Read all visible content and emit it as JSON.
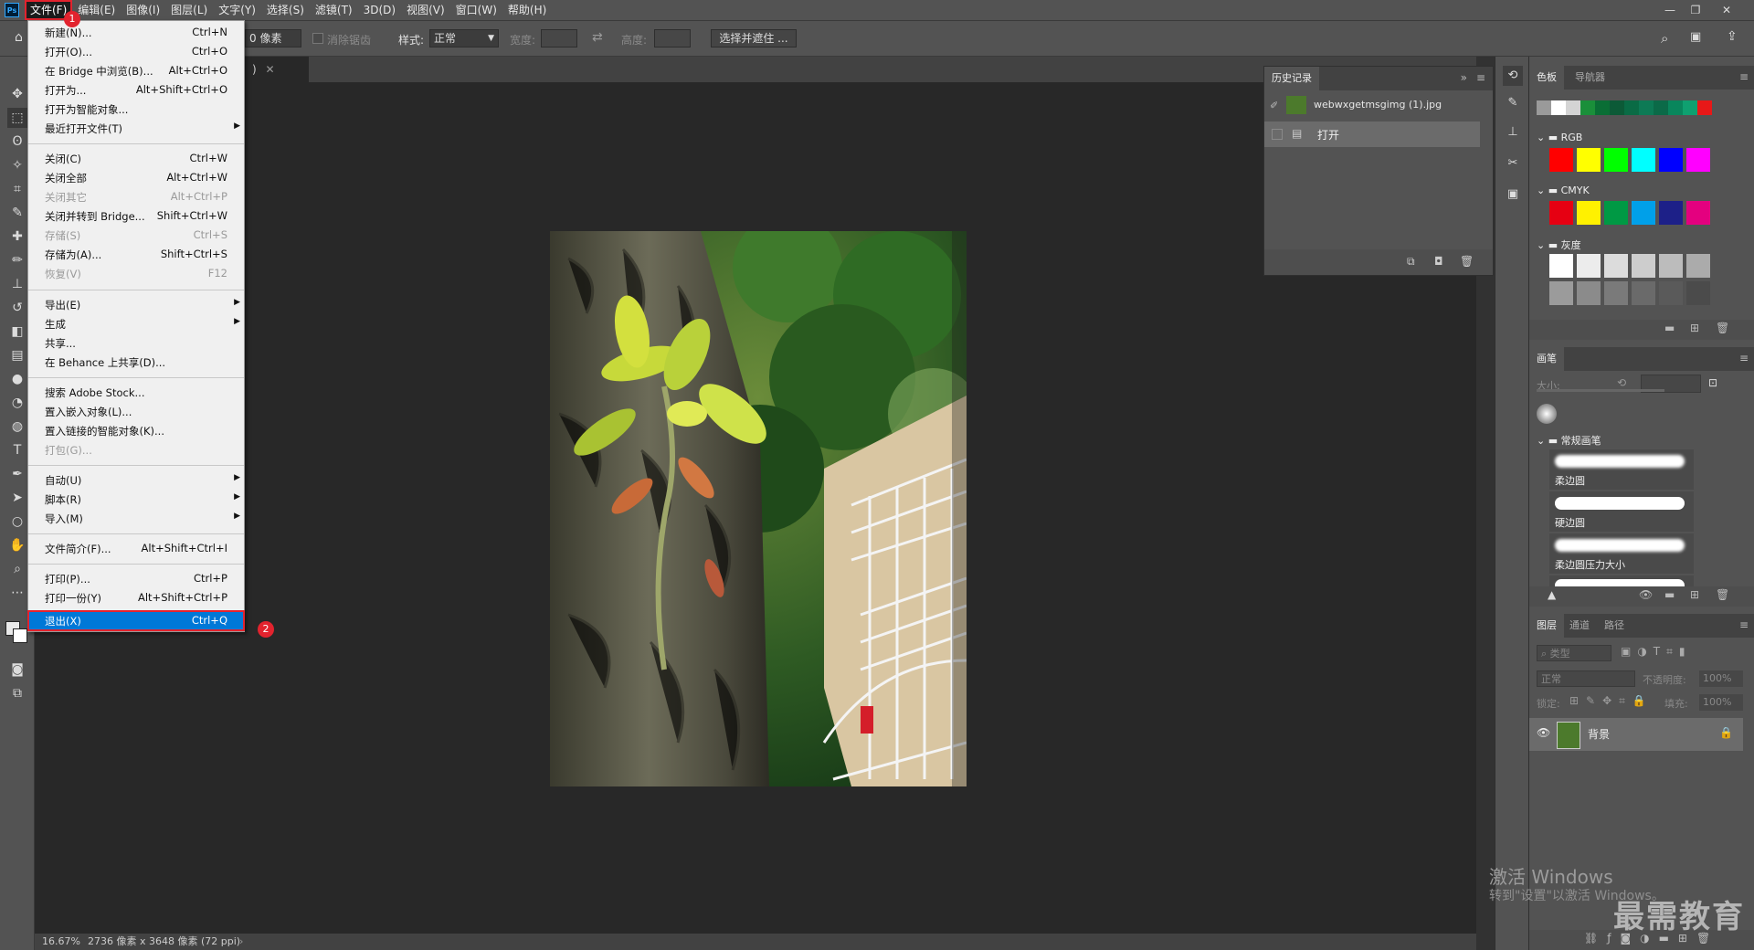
{
  "menubar": {
    "logo": "Ps",
    "items": [
      "文件(F)",
      "编辑(E)",
      "图像(I)",
      "图层(L)",
      "文字(Y)",
      "选择(S)",
      "滤镜(T)",
      "3D(D)",
      "视图(V)",
      "窗口(W)",
      "帮助(H)"
    ]
  },
  "options_bar": {
    "feather_value": "0 像素",
    "antialias_label": "消除锯齿",
    "style_label": "样式:",
    "style_value": "正常",
    "width_label": "宽度:",
    "height_label": "高度:",
    "select_mask_label": "选择并遮住 ..."
  },
  "file_menu": {
    "items": [
      {
        "label": "新建(N)...",
        "shortcut": "Ctrl+N"
      },
      {
        "label": "打开(O)...",
        "shortcut": "Ctrl+O"
      },
      {
        "label": "在 Bridge 中浏览(B)...",
        "shortcut": "Alt+Ctrl+O"
      },
      {
        "label": "打开为...",
        "shortcut": "Alt+Shift+Ctrl+O"
      },
      {
        "label": "打开为智能对象...",
        "shortcut": ""
      },
      {
        "label": "最近打开文件(T)",
        "shortcut": ""
      },
      {
        "label": "关闭(C)",
        "shortcut": "Ctrl+W"
      },
      {
        "label": "关闭全部",
        "shortcut": "Alt+Ctrl+W"
      },
      {
        "label": "关闭其它",
        "shortcut": "Alt+Ctrl+P"
      },
      {
        "label": "关闭并转到 Bridge...",
        "shortcut": "Shift+Ctrl+W"
      },
      {
        "label": "存储(S)",
        "shortcut": "Ctrl+S"
      },
      {
        "label": "存储为(A)...",
        "shortcut": "Shift+Ctrl+S"
      },
      {
        "label": "恢复(V)",
        "shortcut": "F12"
      },
      {
        "label": "导出(E)",
        "shortcut": ""
      },
      {
        "label": "生成",
        "shortcut": ""
      },
      {
        "label": "共享...",
        "shortcut": ""
      },
      {
        "label": "在 Behance 上共享(D)...",
        "shortcut": ""
      },
      {
        "label": "搜索 Adobe Stock...",
        "shortcut": ""
      },
      {
        "label": "置入嵌入对象(L)...",
        "shortcut": ""
      },
      {
        "label": "置入链接的智能对象(K)...",
        "shortcut": ""
      },
      {
        "label": "打包(G)...",
        "shortcut": ""
      },
      {
        "label": "自动(U)",
        "shortcut": ""
      },
      {
        "label": "脚本(R)",
        "shortcut": ""
      },
      {
        "label": "导入(M)",
        "shortcut": ""
      },
      {
        "label": "文件简介(F)...",
        "shortcut": "Alt+Shift+Ctrl+I"
      },
      {
        "label": "打印(P)...",
        "shortcut": "Ctrl+P"
      },
      {
        "label": "打印一份(Y)",
        "shortcut": "Alt+Shift+Ctrl+P"
      },
      {
        "label": "退出(X)",
        "shortcut": "Ctrl+Q"
      }
    ],
    "badge1": "1",
    "badge2": "2"
  },
  "history_panel": {
    "tab": "历史记录",
    "snapshot_name": "webwxgetmsgimg (1).jpg",
    "step": "打开"
  },
  "swatches_panel": {
    "tab_active": "色板",
    "tab_other": "导航器",
    "group_rgb": "RGB",
    "group_cmyk": "CMYK",
    "group_gray": "灰度",
    "recent_colors": [
      "#9a9a9a",
      "#ffffff",
      "#d4d4d4",
      "#1a8f3a",
      "#0a6e35",
      "#0c5a37",
      "#0a6b45",
      "#0d7a55",
      "#0b6a48",
      "#09865c",
      "#0fa070",
      "#e81818"
    ],
    "rgb_colors": [
      "#ff0000",
      "#ffff00",
      "#00ff00",
      "#00ffff",
      "#0000ff",
      "#ff00ff"
    ],
    "cmyk_colors": [
      "#e60012",
      "#fff100",
      "#009944",
      "#00a0e9",
      "#1d2088",
      "#e4007f"
    ],
    "gray_colors": [
      "#ffffff",
      "#ececec",
      "#dcdcdc",
      "#cdcdcd",
      "#bcbcbc",
      "#ababab",
      "#9b9b9b",
      "#8b8b8b",
      "#7a7a7a",
      "#6a6a6a",
      "#5a5a5a",
      "#4b4b4b"
    ]
  },
  "brush_panel": {
    "tab": "画笔",
    "size_label": "大小:",
    "group": "常规画笔",
    "brushes": [
      "柔边圆",
      "硬边圆",
      "柔边圆压力大小"
    ]
  },
  "layers_panel": {
    "tabs": [
      "图层",
      "通道",
      "路径"
    ],
    "filter_placeholder": "类型",
    "blend_mode": "正常",
    "opacity_label": "不透明度:",
    "opacity_value": "100%",
    "lock_label": "锁定:",
    "fill_label": "填充:",
    "fill_value": "100%",
    "layer_name": "背景"
  },
  "status_bar": {
    "zoom": "16.67%",
    "doc_info": "2736 像素 x 3648 像素 (72 ppi)"
  },
  "overlay": {
    "activate_title": "激活 Windows",
    "activate_sub": "转到\"设置\"以激活 Windows。",
    "logo_text": "最需教育"
  }
}
